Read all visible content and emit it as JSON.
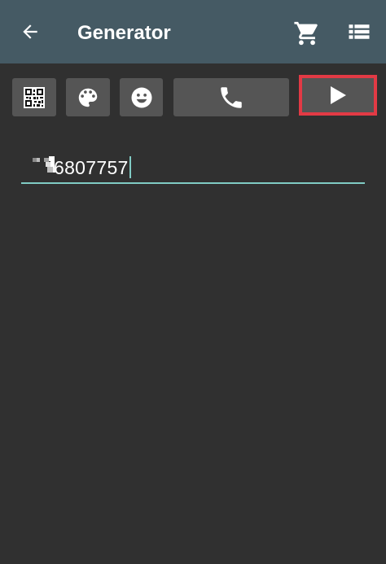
{
  "header": {
    "title": "Generator",
    "icons": {
      "back": "arrow-left-icon",
      "cart": "shopping-cart-icon",
      "menu": "list-icon"
    }
  },
  "toolbar": {
    "buttons": [
      {
        "name": "qr-code-button",
        "icon": "qr-code-icon"
      },
      {
        "name": "color-palette-button",
        "icon": "palette-icon"
      },
      {
        "name": "emoji-button",
        "icon": "smiley-icon"
      },
      {
        "name": "phone-button",
        "icon": "phone-icon"
      },
      {
        "name": "play-button",
        "icon": "play-icon",
        "highlighted": true
      }
    ]
  },
  "input": {
    "value": "6807757"
  },
  "colors": {
    "appbar": "#455a64",
    "background": "#303030",
    "button": "#555555",
    "accent": "#80cbc4",
    "highlight": "#e23a45"
  }
}
